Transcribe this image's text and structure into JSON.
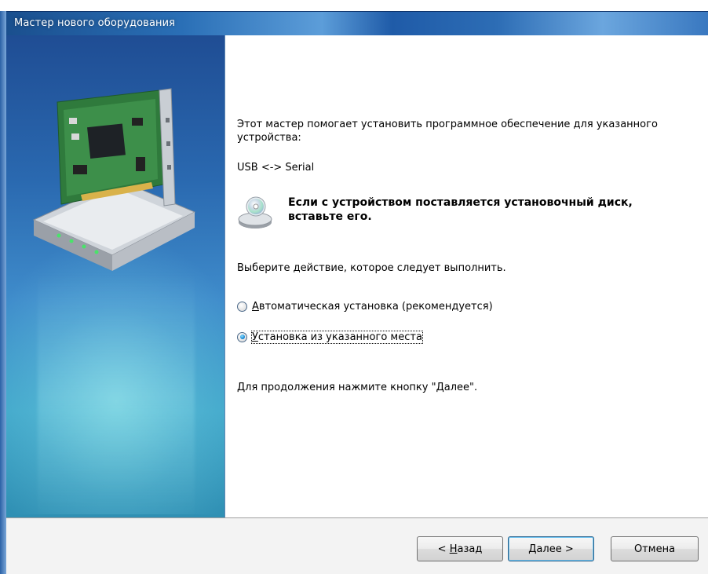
{
  "window": {
    "title": "Мастер нового оборудования"
  },
  "content": {
    "intro": "Этот мастер помогает установить программное обеспечение для указанного устройства:",
    "device_name": "USB <-> Serial",
    "cd_notice": "Если с устройством поставляется установочный диск, вставьте его.",
    "action_prompt": "Выберите действие, которое следует выполнить.",
    "options": [
      {
        "mnemonic": "А",
        "label_rest": "втоматическая установка (рекомендуется)",
        "selected": false
      },
      {
        "mnemonic": "У",
        "label_rest": "становка из указанного места",
        "selected": true
      }
    ],
    "continue_hint": "Для продолжения нажмите кнопку \"Далее\"."
  },
  "buttons": {
    "back": {
      "prefix": "< ",
      "mnemonic": "Н",
      "rest": "азад"
    },
    "next": {
      "mnemonic": "Д",
      "rest": "алее >"
    },
    "cancel": "Отмена"
  },
  "icons": {
    "hardware": "network-card-illustration",
    "cd": "cd-drive-icon"
  },
  "colors": {
    "titlebar": "#2a6fb6",
    "side_panel": "#2a69b0",
    "radio_checked": "#1a8bd6"
  }
}
